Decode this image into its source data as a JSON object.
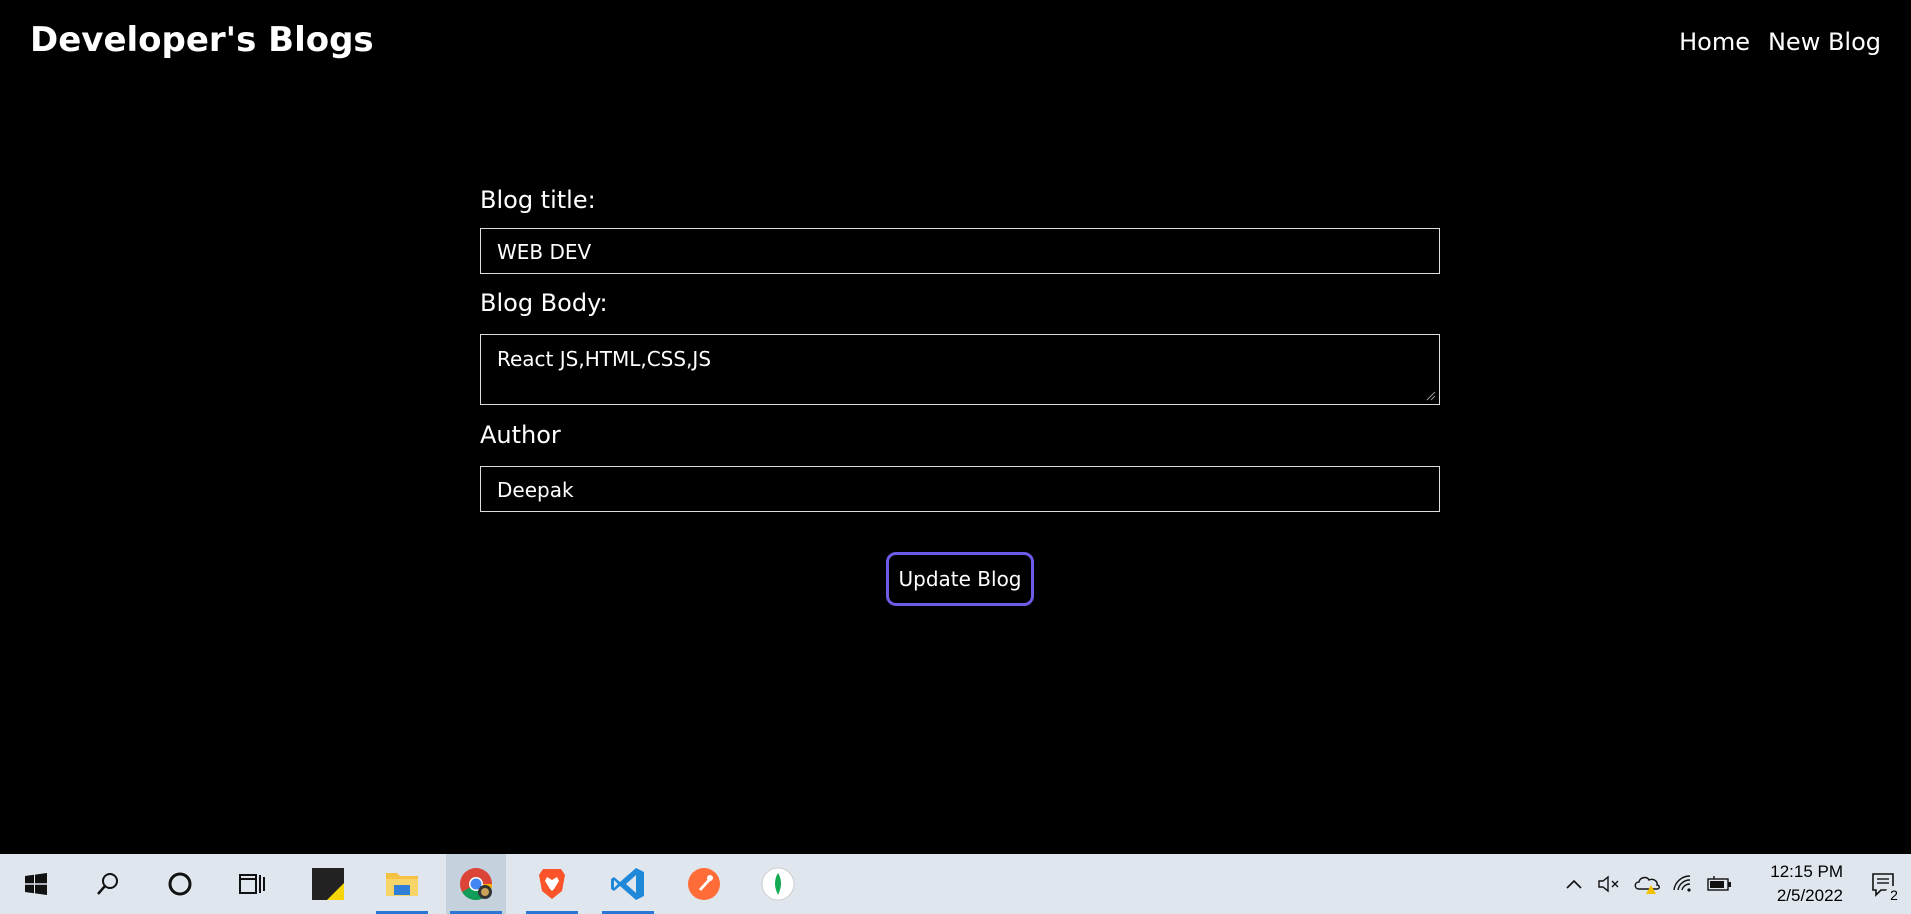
{
  "navbar": {
    "brand": "Developer's Blogs",
    "links": [
      "Home",
      "New Blog"
    ]
  },
  "form": {
    "title_label": "Blog title:",
    "title_value": "WEB DEV",
    "body_label": "Blog Body:",
    "body_value": "React JS,HTML,CSS,JS",
    "author_label": "Author",
    "author_value": "Deepak",
    "submit_label": "Update Blog"
  },
  "colors": {
    "background": "#000000",
    "button_border": "#6c5ce7",
    "taskbar": "#dfe6ee"
  },
  "taskbar": {
    "apps": [
      "windows-start-icon",
      "search-icon",
      "cortana-icon",
      "task-view-icon",
      "sticky-notes-icon",
      "file-explorer-icon",
      "chrome-icon",
      "brave-icon",
      "vscode-icon",
      "postman-icon",
      "mongodb-compass-icon"
    ],
    "tray": [
      "chevron-up-icon",
      "volume-muted-icon",
      "onedrive-icon",
      "wifi-icon",
      "battery-icon"
    ],
    "time": "12:15 PM",
    "date": "2/5/2022",
    "notification_count": "2"
  }
}
